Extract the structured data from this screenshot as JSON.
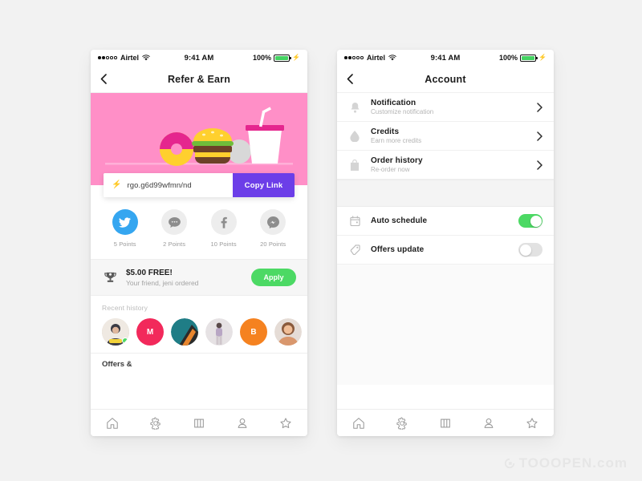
{
  "statusbar": {
    "carrier": "Airtel",
    "time": "9:41 AM",
    "battery_pct": "100%",
    "signal_icon": "signal-dots-icon",
    "wifi_icon": "wifi-icon",
    "battery_icon": "battery-icon",
    "charging_icon": "lightning-bolt-icon"
  },
  "left_screen": {
    "nav": {
      "title": "Refer & Earn",
      "back_icon": "chevron-left-icon"
    },
    "hero": {
      "illustration": "burger-donut-drink-illustration",
      "bg_color": "#ff8fc7"
    },
    "link": {
      "icon": "lightning-bolt-icon",
      "value": "rgo.g6d99wfmn/nd",
      "placeholder": "rgo.g6d99wfmn/nd",
      "copy_label": "Copy Link",
      "copy_color": "#6c3ee8"
    },
    "social": [
      {
        "name": "twitter",
        "icon": "twitter-icon",
        "points": "5 Points",
        "color": "#35a6f0",
        "active": true
      },
      {
        "name": "chat",
        "icon": "chat-bubble-icon",
        "points": "2 Points",
        "color": "#ededed",
        "active": false
      },
      {
        "name": "facebook",
        "icon": "facebook-icon",
        "points": "10 Points",
        "color": "#ededed",
        "active": false
      },
      {
        "name": "messenger",
        "icon": "messenger-icon",
        "points": "20 Points",
        "color": "#ededed",
        "active": false
      }
    ],
    "promo": {
      "icon": "trophy-icon",
      "title": "$5.00 FREE!",
      "subtitle": "Your friend, jeni ordered",
      "apply_label": "Apply",
      "apply_color": "#4cd964"
    },
    "recent": {
      "title": "Recent history",
      "avatars": [
        {
          "type": "photo",
          "label": "",
          "color": "#c9b9a8",
          "online": true
        },
        {
          "type": "initial",
          "label": "M",
          "color": "#f2295b",
          "online": false
        },
        {
          "type": "photo",
          "label": "",
          "color": "#1f7d86",
          "online": false
        },
        {
          "type": "photo",
          "label": "",
          "color": "#d8d2d4",
          "online": false
        },
        {
          "type": "initial",
          "label": "B",
          "color": "#f58220",
          "online": false
        },
        {
          "type": "photo",
          "label": "",
          "color": "#d9976d",
          "online": false
        }
      ]
    },
    "offers_teaser": "Offers &"
  },
  "right_screen": {
    "nav": {
      "title": "Account",
      "back_icon": "chevron-left-icon"
    },
    "rows": [
      {
        "icon": "bell-icon",
        "title": "Notification",
        "subtitle": "Customize notification",
        "chevron": "chevron-right-icon"
      },
      {
        "icon": "water-drop-icon",
        "title": "Credits",
        "subtitle": "Earn more credits",
        "chevron": "chevron-right-icon"
      },
      {
        "icon": "bag-icon",
        "title": "Order history",
        "subtitle": "Re-order now",
        "chevron": "chevron-right-icon"
      }
    ],
    "toggles": [
      {
        "icon": "calendar-icon",
        "title": "Auto schedule",
        "on": true,
        "on_color": "#4cd964"
      },
      {
        "icon": "tag-icon",
        "title": "Offers update",
        "on": false,
        "off_color": "#e2e2e2"
      }
    ]
  },
  "tabbar": [
    {
      "name": "home",
      "icon": "home-icon"
    },
    {
      "name": "settings",
      "icon": "gear-icon"
    },
    {
      "name": "explore",
      "icon": "book-icon"
    },
    {
      "name": "profile",
      "icon": "person-icon"
    },
    {
      "name": "favorites",
      "icon": "star-icon"
    }
  ],
  "watermark": {
    "text": "TOOOPEN.com"
  }
}
